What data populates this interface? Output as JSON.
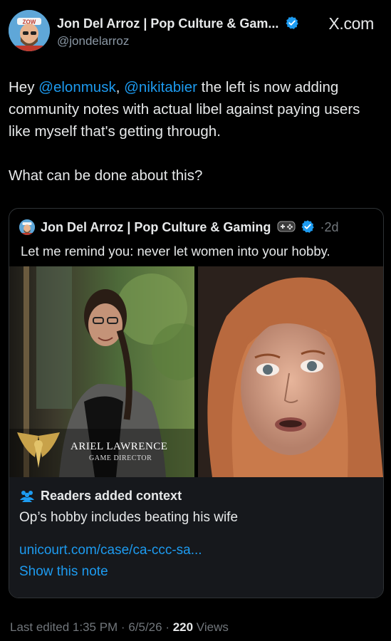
{
  "post": {
    "author_name": "Jon Del Arroz | Pop Culture & Gam...",
    "author_handle": "@jondelarroz",
    "brand": "X.com",
    "text_part1": "Hey ",
    "mention1": "@elonmusk",
    "text_comma": ", ",
    "mention2": "@nikitabier",
    "text_part2": "  the left is now adding community notes with actual libel against paying users like myself that's getting through.",
    "text_paragraph2": "What can be done about this?",
    "avatar_badge": "ZOW"
  },
  "quote": {
    "author_name": "Jon Del Arroz | Pop Culture & Gaming",
    "time": "2d",
    "separator": "·",
    "text": "Let me remind you: never let women into your hobby.",
    "image_left_caption_name": "ARIEL LAWRENCE",
    "image_left_caption_role": "GAME DIRECTOR"
  },
  "context": {
    "title": "Readers added context",
    "body": "Op’s hobby includes beating his wife",
    "link": "unicourt.com/case/ca-ccc-sa...",
    "show_note": "Show this note"
  },
  "footer": {
    "edited": "Last edited 1:35 PM · 6/5/26",
    "sep": " · ",
    "views_count": "220",
    "views_label": " Views"
  },
  "colors": {
    "background": "#000000",
    "link": "#1d9bf0",
    "verified": "#1d9bf0",
    "context_bg": "#16181c",
    "muted": "#71767b"
  },
  "icons": [
    "verified-badge-icon",
    "x-logo",
    "controller-icon",
    "readers-context-icon",
    "winged-emblem-icon"
  ]
}
